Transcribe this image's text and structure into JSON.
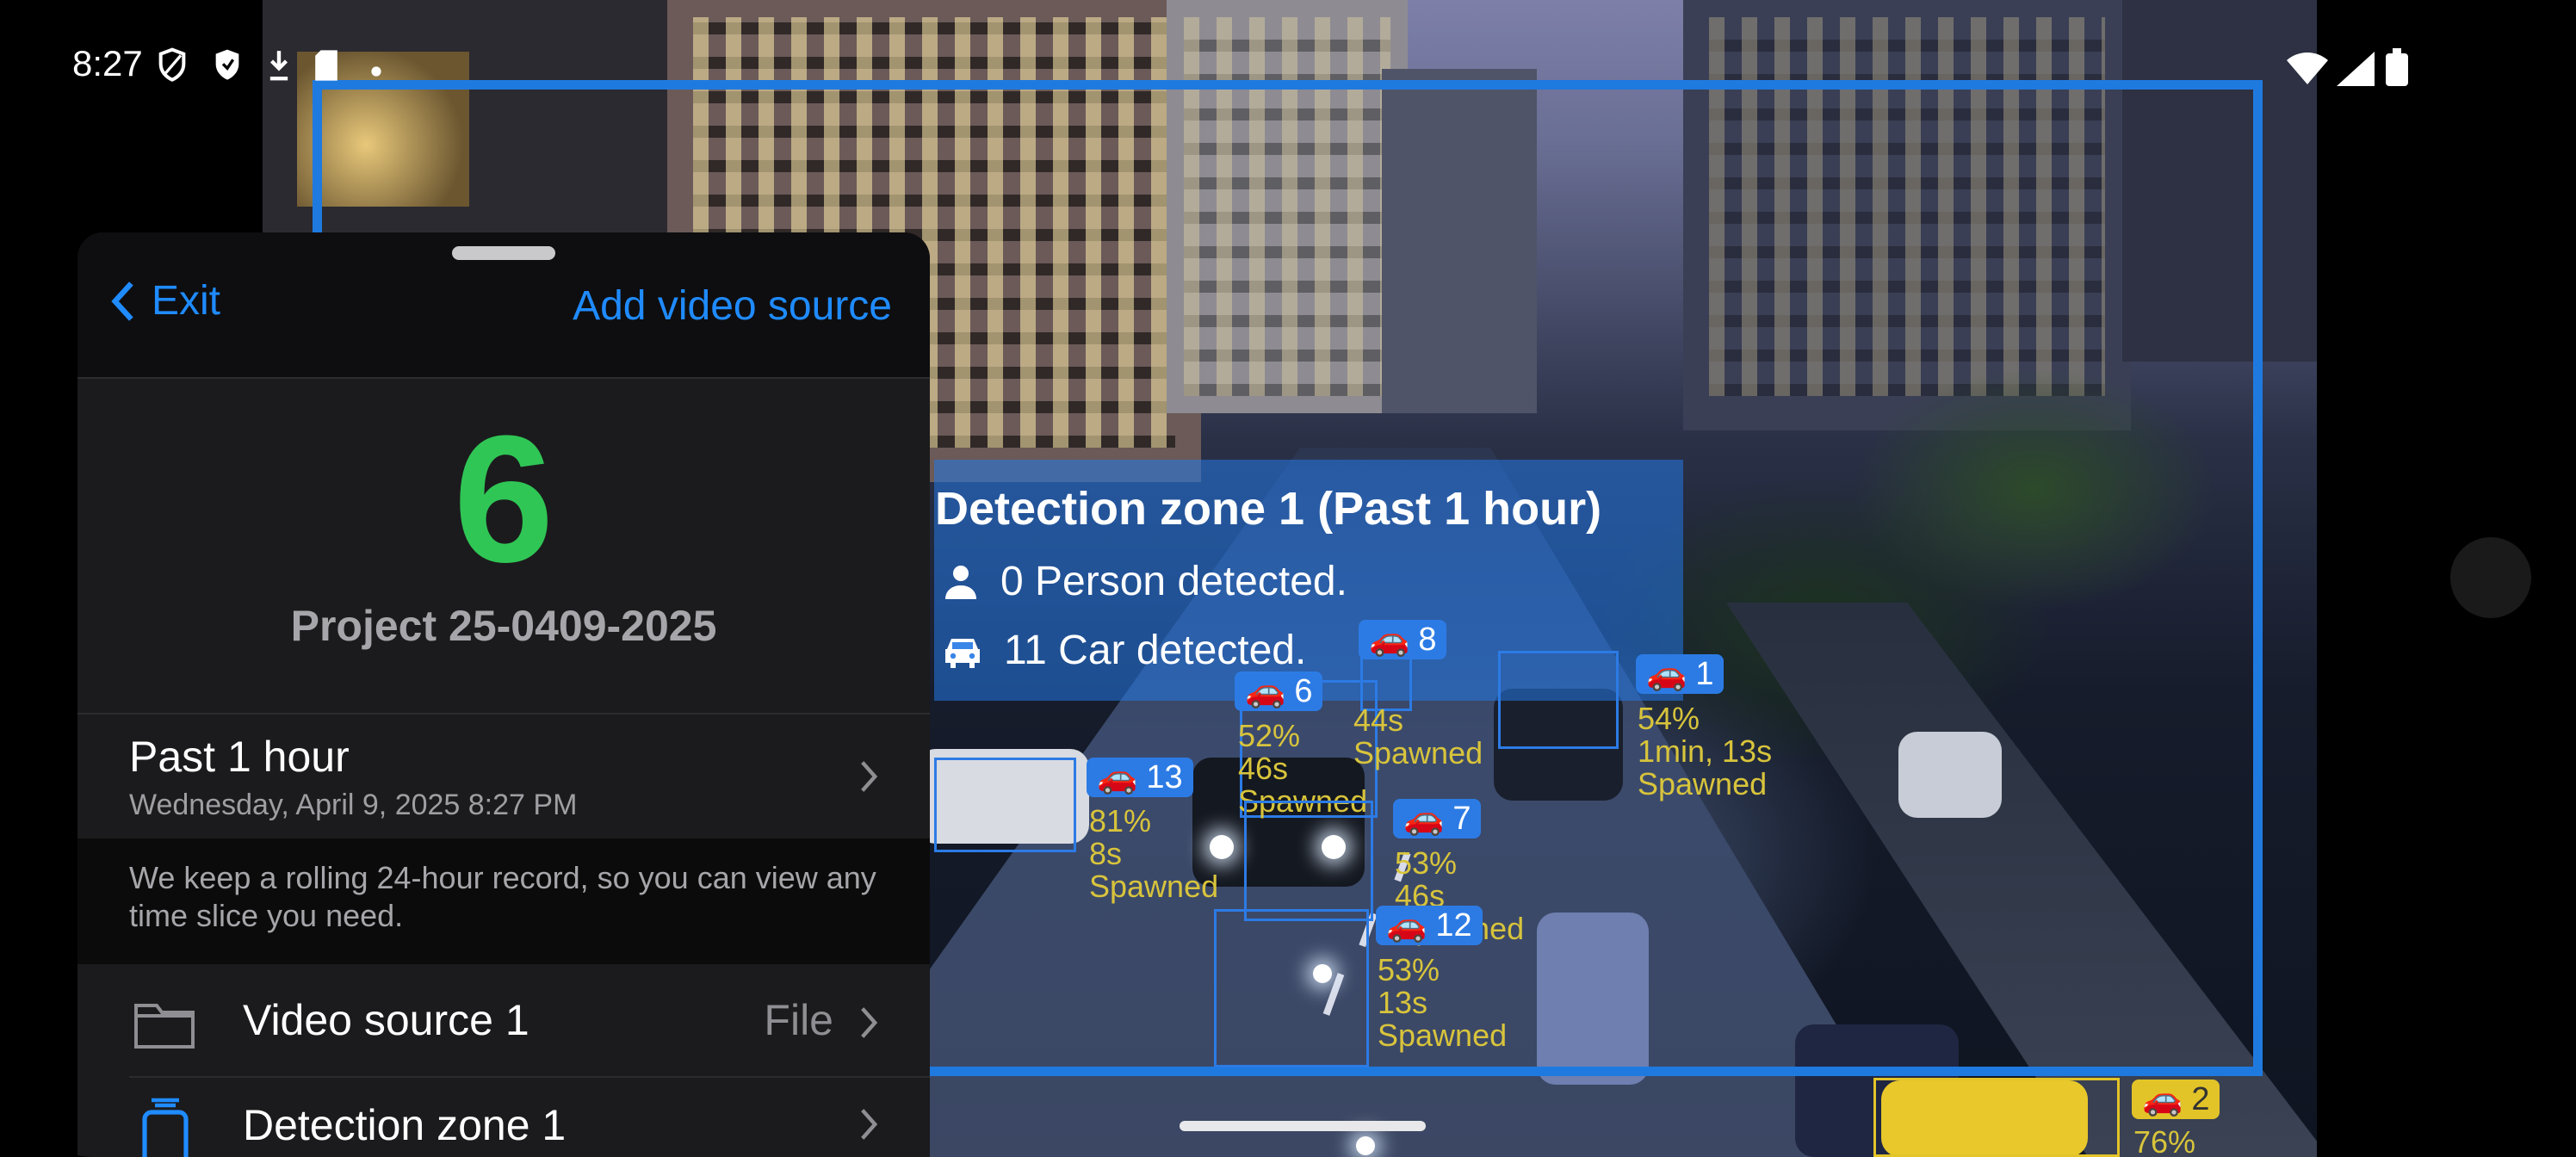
{
  "status_bar": {
    "time": "8:27"
  },
  "camera": {
    "zone": {
      "title": "Detection zone 1 (Past 1 hour)",
      "person_count_text": "0 Person detected.",
      "car_count_text": "11 Car detected."
    },
    "tracks": [
      {
        "id": "8"
      },
      {
        "id": "6",
        "conf": "52%",
        "age": "46s",
        "state": "Spawned"
      },
      {
        "id": "1",
        "conf": "54%",
        "age": "1min, 13s",
        "state": "Spawned"
      },
      {
        "id": "13",
        "conf": "81%",
        "age": "8s",
        "state": "Spawned"
      },
      {
        "id": "7",
        "conf": "53%",
        "age": "46s",
        "state": "Spawned"
      },
      {
        "id": "12",
        "conf": "53%",
        "age": "13s",
        "state": "Spawned"
      },
      {
        "id": "2",
        "conf": "76%"
      }
    ],
    "partial_track": {
      "age": "44s",
      "state": "Spawned"
    }
  },
  "sheet": {
    "exit_label": "Exit",
    "add_source_label": "Add video source",
    "count": "6",
    "project_name": "Project 25-0409-2025",
    "time_range": {
      "title": "Past 1 hour",
      "subtitle": "Wednesday, April 9, 2025 8:27 PM"
    },
    "note": "We keep a rolling 24-hour record, so you can view any time slice you need.",
    "rows": [
      {
        "label": "Video source 1",
        "value": "File"
      },
      {
        "label": "Detection zone 1"
      }
    ]
  },
  "colors": {
    "accent": "#1f8bff",
    "count_green": "#2fc655",
    "zone_blue": "#1f7ae0",
    "track_yellow": "#d8c43c"
  }
}
